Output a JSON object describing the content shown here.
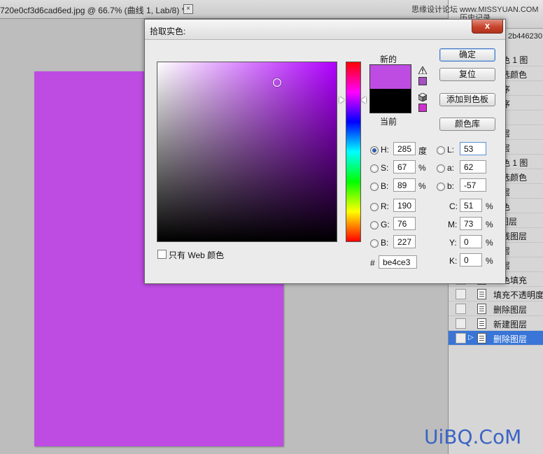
{
  "document": {
    "tab_title": "720e0cf3d6cad6ed.jpg @ 66.7% (曲线 1, Lab/8) *",
    "close_glyph": "×",
    "canvas_color": "#be4ce3"
  },
  "watermark_top": "思缘设计论坛 www.MISSYUAN.COM",
  "watermark_bottom": "UiBQ.CoM",
  "history_panel": {
    "tab_label": "历史记录",
    "snapshot_label": "2b446230",
    "items": [
      {
        "label": "颜色 1 图"
      },
      {
        "label": "可选颜色"
      },
      {
        "label": "顺序"
      },
      {
        "label": "顺序"
      },
      {
        "label": ""
      },
      {
        "label": "图层"
      },
      {
        "label": "图层"
      },
      {
        "label": "颜色 1 图"
      },
      {
        "label": "可选颜色"
      },
      {
        "label": "图层"
      },
      {
        "label": "颜色"
      },
      {
        "label": "1 图层"
      },
      {
        "label": "曲线图层"
      },
      {
        "label": "图层"
      },
      {
        "label": "图层"
      },
      {
        "label": "颜色填充"
      },
      {
        "label": "填充不透明度"
      },
      {
        "label": "删除图层"
      },
      {
        "label": "新建图层"
      },
      {
        "label": "删除图层",
        "active": true
      }
    ]
  },
  "dialog": {
    "title": "拾取实色:",
    "close_glyph": "x",
    "new_label": "新的",
    "current_label": "当前",
    "new_color": "#be4ce3",
    "current_color": "#000000",
    "gamut_swatch_color": "#a550c4",
    "websafe_swatch_color": "#cc33cc",
    "buttons": {
      "ok": "确定",
      "reset": "复位",
      "add_to_swatches": "添加到色板",
      "color_libraries": "颜色库"
    },
    "web_colors_only_label": "只有 Web 颜色",
    "hsb": {
      "h_label": "H:",
      "h_value": "285",
      "h_unit": "度",
      "s_label": "S:",
      "s_value": "67",
      "s_unit": "%",
      "b_label": "B:",
      "b_value": "89",
      "b_unit": "%"
    },
    "lab": {
      "l_label": "L:",
      "l_value": "53",
      "a_label": "a:",
      "a_value": "62",
      "b_label": "b:",
      "b_value": "-57"
    },
    "rgb": {
      "r_label": "R:",
      "r_value": "190",
      "g_label": "G:",
      "g_value": "76",
      "b_label": "B:",
      "b_value": "227"
    },
    "cmyk": {
      "c_label": "C:",
      "c_value": "51",
      "m_label": "M:",
      "m_value": "73",
      "y_label": "Y:",
      "y_value": "0",
      "k_label": "K:",
      "k_value": "0",
      "unit": "%"
    },
    "hex_label": "#",
    "hex_value": "be4ce3"
  }
}
